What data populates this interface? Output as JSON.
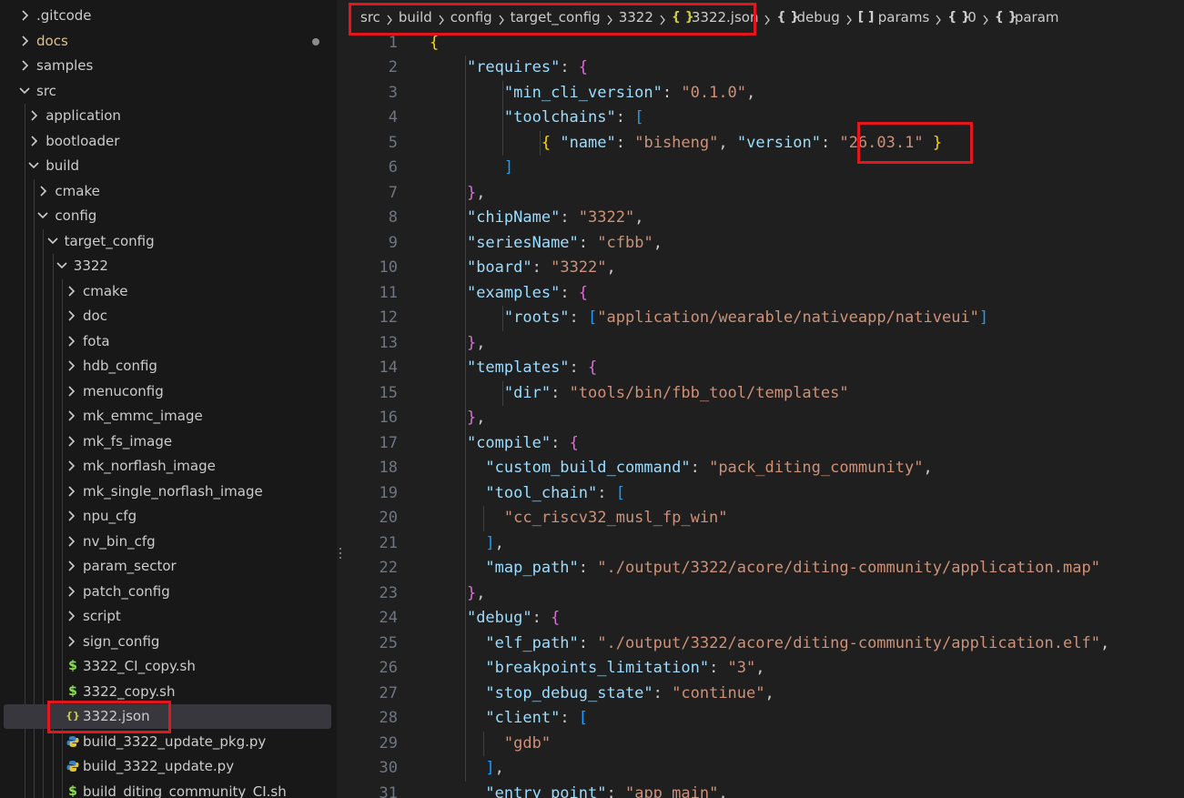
{
  "colors": {
    "accent_highlight": "#e3161e",
    "json_icon": "#cbcb41",
    "shell_icon": "#89e051",
    "python_icon": "#3b82c4",
    "docs_modified": "#e2c08d"
  },
  "explorer": {
    "items": [
      {
        "label": ".gitcode",
        "depth": 0,
        "kind": "folder",
        "open": false
      },
      {
        "label": "docs",
        "depth": 0,
        "kind": "folder",
        "open": false,
        "modified": true
      },
      {
        "label": "samples",
        "depth": 0,
        "kind": "folder",
        "open": false
      },
      {
        "label": "src",
        "depth": 0,
        "kind": "folder",
        "open": true
      },
      {
        "label": "application",
        "depth": 1,
        "kind": "folder",
        "open": false
      },
      {
        "label": "bootloader",
        "depth": 1,
        "kind": "folder",
        "open": false
      },
      {
        "label": "build",
        "depth": 1,
        "kind": "folder",
        "open": true
      },
      {
        "label": "cmake",
        "depth": 2,
        "kind": "folder",
        "open": false
      },
      {
        "label": "config",
        "depth": 2,
        "kind": "folder",
        "open": true
      },
      {
        "label": "target_config",
        "depth": 3,
        "kind": "folder",
        "open": true
      },
      {
        "label": "3322",
        "depth": 4,
        "kind": "folder",
        "open": true
      },
      {
        "label": "cmake",
        "depth": 5,
        "kind": "folder",
        "open": false
      },
      {
        "label": "doc",
        "depth": 5,
        "kind": "folder",
        "open": false
      },
      {
        "label": "fota",
        "depth": 5,
        "kind": "folder",
        "open": false
      },
      {
        "label": "hdb_config",
        "depth": 5,
        "kind": "folder",
        "open": false
      },
      {
        "label": "menuconfig",
        "depth": 5,
        "kind": "folder",
        "open": false
      },
      {
        "label": "mk_emmc_image",
        "depth": 5,
        "kind": "folder",
        "open": false
      },
      {
        "label": "mk_fs_image",
        "depth": 5,
        "kind": "folder",
        "open": false
      },
      {
        "label": "mk_norflash_image",
        "depth": 5,
        "kind": "folder",
        "open": false
      },
      {
        "label": "mk_single_norflash_image",
        "depth": 5,
        "kind": "folder",
        "open": false
      },
      {
        "label": "npu_cfg",
        "depth": 5,
        "kind": "folder",
        "open": false
      },
      {
        "label": "nv_bin_cfg",
        "depth": 5,
        "kind": "folder",
        "open": false
      },
      {
        "label": "param_sector",
        "depth": 5,
        "kind": "folder",
        "open": false
      },
      {
        "label": "patch_config",
        "depth": 5,
        "kind": "folder",
        "open": false
      },
      {
        "label": "script",
        "depth": 5,
        "kind": "folder",
        "open": false
      },
      {
        "label": "sign_config",
        "depth": 5,
        "kind": "folder",
        "open": false
      },
      {
        "label": "3322_CI_copy.sh",
        "depth": 5,
        "kind": "shell"
      },
      {
        "label": "3322_copy.sh",
        "depth": 5,
        "kind": "shell"
      },
      {
        "label": "3322.json",
        "depth": 5,
        "kind": "json",
        "selected": true
      },
      {
        "label": "build_3322_update_pkg.py",
        "depth": 5,
        "kind": "python"
      },
      {
        "label": "build_3322_update.py",
        "depth": 5,
        "kind": "python"
      },
      {
        "label": "build_diting_community_CI.sh",
        "depth": 5,
        "kind": "shell"
      }
    ]
  },
  "breadcrumb": [
    {
      "label": "src",
      "icon": ""
    },
    {
      "label": "build",
      "icon": ""
    },
    {
      "label": "config",
      "icon": ""
    },
    {
      "label": "target_config",
      "icon": ""
    },
    {
      "label": "3322",
      "icon": ""
    },
    {
      "label": "3322.json",
      "icon": "{}"
    },
    {
      "label": "debug",
      "icon": "{}"
    },
    {
      "label": "params",
      "icon": "[]"
    },
    {
      "label": "0",
      "icon": "{}"
    },
    {
      "label": "param",
      "icon": "{}"
    }
  ],
  "code": {
    "line_numbers": [
      "1",
      "2",
      "3",
      "4",
      "5",
      "6",
      "7",
      "8",
      "9",
      "10",
      "11",
      "12",
      "13",
      "14",
      "15",
      "16",
      "17",
      "18",
      "19",
      "20",
      "21",
      "22",
      "23",
      "24",
      "25",
      "26",
      "27",
      "28",
      "29",
      "30",
      "31"
    ],
    "lines": [
      [
        [
          "{",
          "b1"
        ]
      ],
      [
        [
          "    ",
          ""
        ],
        [
          "\"requires\"",
          "k"
        ],
        [
          ": ",
          "p"
        ],
        [
          "{",
          "b2"
        ]
      ],
      [
        [
          "        ",
          ""
        ],
        [
          "\"min_cli_version\"",
          "k"
        ],
        [
          ": ",
          "p"
        ],
        [
          "\"0.1.0\"",
          "s"
        ],
        [
          ",",
          "p"
        ]
      ],
      [
        [
          "        ",
          ""
        ],
        [
          "\"toolchains\"",
          "k"
        ],
        [
          ": ",
          "p"
        ],
        [
          "[",
          "b3"
        ]
      ],
      [
        [
          "            ",
          ""
        ],
        [
          "{",
          "b1"
        ],
        [
          " ",
          ""
        ],
        [
          "\"name\"",
          "k"
        ],
        [
          ": ",
          "p"
        ],
        [
          "\"bisheng\"",
          "s"
        ],
        [
          ", ",
          "p"
        ],
        [
          "\"version\"",
          "k"
        ],
        [
          ": ",
          "p"
        ],
        [
          "\"26.03.1\"",
          "s"
        ],
        [
          " ",
          ""
        ],
        [
          "}",
          "b1"
        ]
      ],
      [
        [
          "        ",
          ""
        ],
        [
          "]",
          "b3"
        ]
      ],
      [
        [
          "    ",
          ""
        ],
        [
          "}",
          "b2"
        ],
        [
          ",",
          "p"
        ]
      ],
      [
        [
          "    ",
          ""
        ],
        [
          "\"chipName\"",
          "k"
        ],
        [
          ": ",
          "p"
        ],
        [
          "\"3322\"",
          "s"
        ],
        [
          ",",
          "p"
        ]
      ],
      [
        [
          "    ",
          ""
        ],
        [
          "\"seriesName\"",
          "k"
        ],
        [
          ": ",
          "p"
        ],
        [
          "\"cfbb\"",
          "s"
        ],
        [
          ",",
          "p"
        ]
      ],
      [
        [
          "    ",
          ""
        ],
        [
          "\"board\"",
          "k"
        ],
        [
          ": ",
          "p"
        ],
        [
          "\"3322\"",
          "s"
        ],
        [
          ",",
          "p"
        ]
      ],
      [
        [
          "    ",
          ""
        ],
        [
          "\"examples\"",
          "k"
        ],
        [
          ": ",
          "p"
        ],
        [
          "{",
          "b2"
        ]
      ],
      [
        [
          "        ",
          ""
        ],
        [
          "\"roots\"",
          "k"
        ],
        [
          ": ",
          "p"
        ],
        [
          "[",
          "b3"
        ],
        [
          "\"application/wearable/nativeapp/nativeui\"",
          "s"
        ],
        [
          "]",
          "b3"
        ]
      ],
      [
        [
          "    ",
          ""
        ],
        [
          "}",
          "b2"
        ],
        [
          ",",
          "p"
        ]
      ],
      [
        [
          "    ",
          ""
        ],
        [
          "\"templates\"",
          "k"
        ],
        [
          ": ",
          "p"
        ],
        [
          "{",
          "b2"
        ]
      ],
      [
        [
          "        ",
          ""
        ],
        [
          "\"dir\"",
          "k"
        ],
        [
          ": ",
          "p"
        ],
        [
          "\"tools/bin/fbb_tool/templates\"",
          "s"
        ]
      ],
      [
        [
          "    ",
          ""
        ],
        [
          "}",
          "b2"
        ],
        [
          ",",
          "p"
        ]
      ],
      [
        [
          "    ",
          ""
        ],
        [
          "\"compile\"",
          "k"
        ],
        [
          ": ",
          "p"
        ],
        [
          "{",
          "b2"
        ]
      ],
      [
        [
          "      ",
          ""
        ],
        [
          "\"custom_build_command\"",
          "k"
        ],
        [
          ": ",
          "p"
        ],
        [
          "\"pack_diting_community\"",
          "s"
        ],
        [
          ",",
          "p"
        ]
      ],
      [
        [
          "      ",
          ""
        ],
        [
          "\"tool_chain\"",
          "k"
        ],
        [
          ": ",
          "p"
        ],
        [
          "[",
          "b3"
        ]
      ],
      [
        [
          "        ",
          ""
        ],
        [
          "\"cc_riscv32_musl_fp_win\"",
          "s"
        ]
      ],
      [
        [
          "      ",
          ""
        ],
        [
          "]",
          "b3"
        ],
        [
          ",",
          "p"
        ]
      ],
      [
        [
          "      ",
          ""
        ],
        [
          "\"map_path\"",
          "k"
        ],
        [
          ": ",
          "p"
        ],
        [
          "\"./output/3322/acore/diting-community/application.map\"",
          "s"
        ]
      ],
      [
        [
          "    ",
          ""
        ],
        [
          "}",
          "b2"
        ],
        [
          ",",
          "p"
        ]
      ],
      [
        [
          "    ",
          ""
        ],
        [
          "\"debug\"",
          "k"
        ],
        [
          ": ",
          "p"
        ],
        [
          "{",
          "b2"
        ]
      ],
      [
        [
          "      ",
          ""
        ],
        [
          "\"elf_path\"",
          "k"
        ],
        [
          ": ",
          "p"
        ],
        [
          "\"./output/3322/acore/diting-community/application.elf\"",
          "s"
        ],
        [
          ",",
          "p"
        ]
      ],
      [
        [
          "      ",
          ""
        ],
        [
          "\"breakpoints_limitation\"",
          "k"
        ],
        [
          ": ",
          "p"
        ],
        [
          "\"3\"",
          "s"
        ],
        [
          ",",
          "p"
        ]
      ],
      [
        [
          "      ",
          ""
        ],
        [
          "\"stop_debug_state\"",
          "k"
        ],
        [
          ": ",
          "p"
        ],
        [
          "\"continue\"",
          "s"
        ],
        [
          ",",
          "p"
        ]
      ],
      [
        [
          "      ",
          ""
        ],
        [
          "\"client\"",
          "k"
        ],
        [
          ": ",
          "p"
        ],
        [
          "[",
          "b3"
        ]
      ],
      [
        [
          "        ",
          ""
        ],
        [
          "\"gdb\"",
          "s"
        ]
      ],
      [
        [
          "      ",
          ""
        ],
        [
          "]",
          "b3"
        ],
        [
          ",",
          "p"
        ]
      ],
      [
        [
          "      ",
          ""
        ],
        [
          "\"entry_point\"",
          "k"
        ],
        [
          ": ",
          "p"
        ],
        [
          "\"app_main\"",
          "s"
        ],
        [
          ",",
          "p"
        ]
      ]
    ]
  }
}
